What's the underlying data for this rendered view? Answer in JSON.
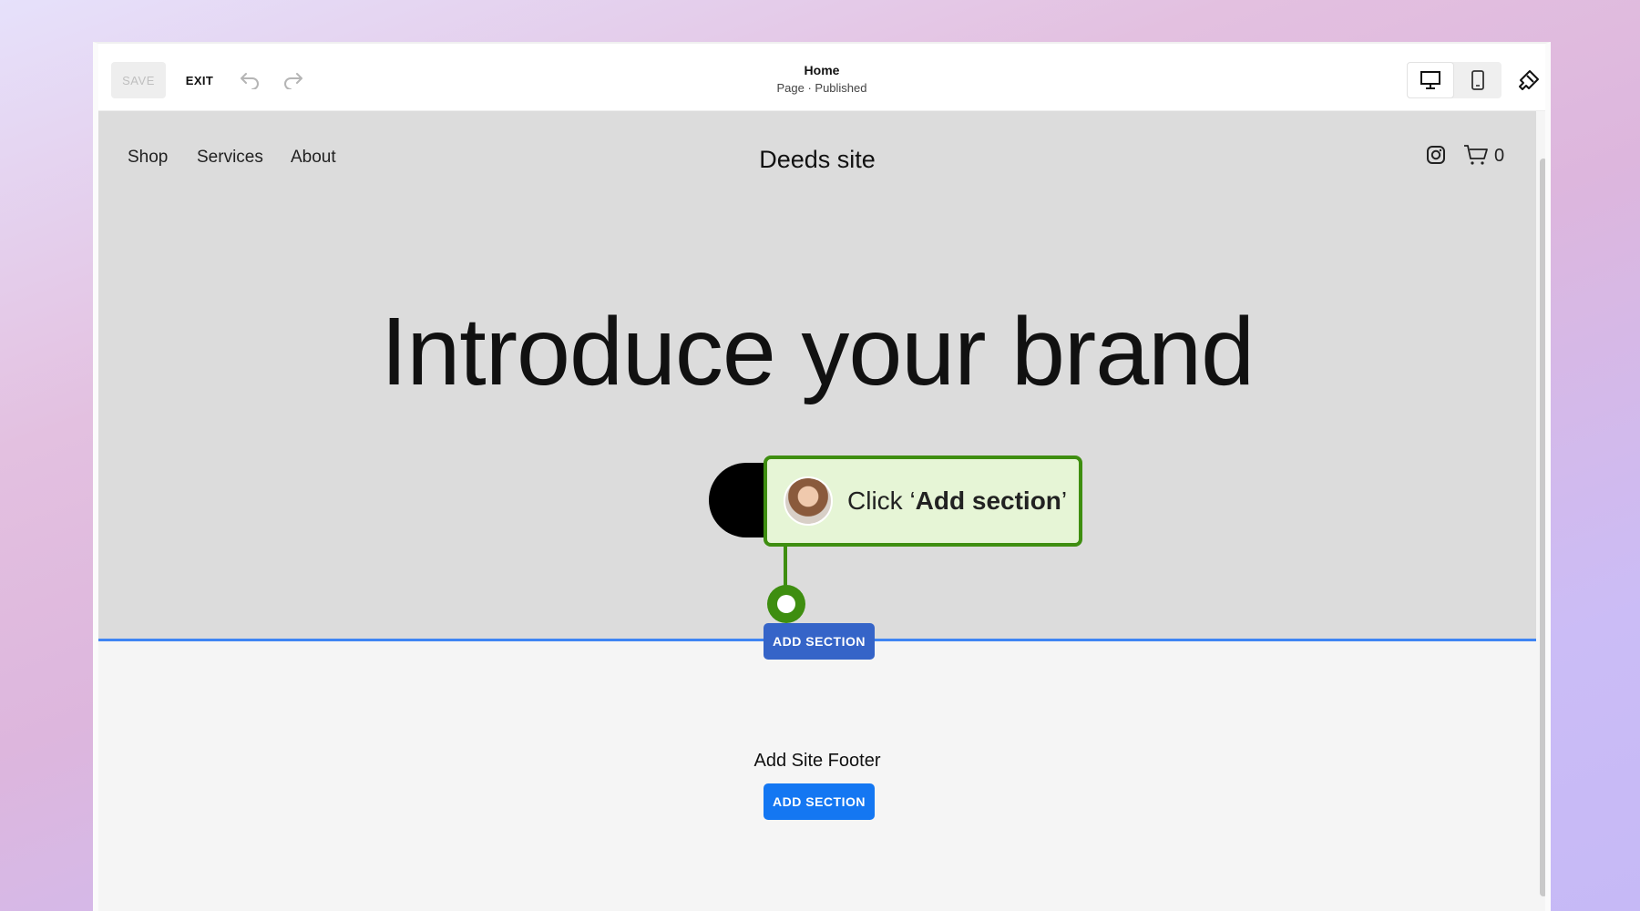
{
  "toolbar": {
    "save_label": "SAVE",
    "exit_label": "EXIT",
    "undo_icon": "undo-icon",
    "redo_icon": "redo-icon",
    "page_title": "Home",
    "page_status": "Page · Published",
    "desktop_icon": "desktop-icon",
    "mobile_icon": "mobile-icon",
    "brush_icon": "paintbrush-icon"
  },
  "site": {
    "nav": [
      "Shop",
      "Services",
      "About"
    ],
    "title": "Deeds site",
    "instagram_icon": "instagram-icon",
    "cart_icon": "cart-icon",
    "cart_count": "0",
    "headline": "Introduce your brand"
  },
  "guide": {
    "prefix": "Click ‘",
    "emphasis": "Add section",
    "suffix": "’"
  },
  "sections": {
    "add_section_label": "ADD SECTION",
    "footer_label": "Add Site Footer",
    "footer_button_label": "ADD SECTION"
  },
  "colors": {
    "accent_blue": "#1477f2",
    "guide_green": "#3e8e10",
    "divider_blue": "#3f85f3"
  }
}
